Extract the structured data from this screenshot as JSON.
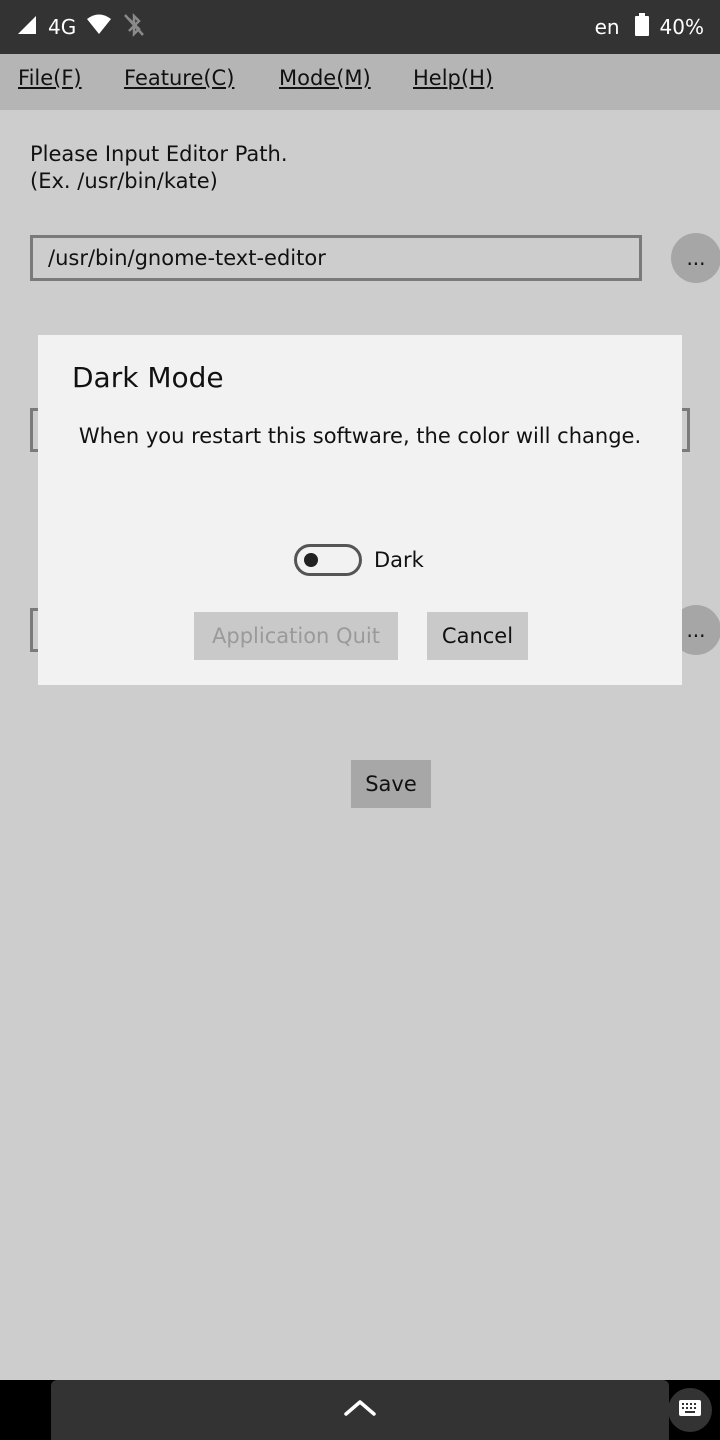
{
  "status_bar": {
    "network": "4G",
    "language": "en",
    "battery": "40%"
  },
  "menu": {
    "items": [
      {
        "mnemonic": "F",
        "rest": "ile(F)"
      },
      {
        "mnemonic": "F",
        "rest": "eature(C)"
      },
      {
        "mnemonic": "M",
        "rest": "ode(M)"
      },
      {
        "mnemonic": "H",
        "rest": "elp(H)"
      }
    ]
  },
  "editor": {
    "label_line1": "Please Input Editor Path.",
    "label_line2": "(Ex. /usr/bin/kate)",
    "path_value": "/usr/bin/gnome-text-editor",
    "browse_label": "..."
  },
  "second_field": {
    "browse_label": "..."
  },
  "save_label": "Save",
  "dialog": {
    "title": "Dark Mode",
    "message": "When you restart this software, the color will change.",
    "toggle_label": "Dark",
    "toggle_on": false,
    "quit_label": "Application Quit",
    "cancel_label": "Cancel"
  },
  "icons": {
    "signal": "signal-icon",
    "wifi": "wifi-icon",
    "bluetooth_off": "bluetooth-off-icon",
    "battery": "battery-icon",
    "chevron_up": "chevron-up-icon",
    "keyboard": "keyboard-icon"
  }
}
